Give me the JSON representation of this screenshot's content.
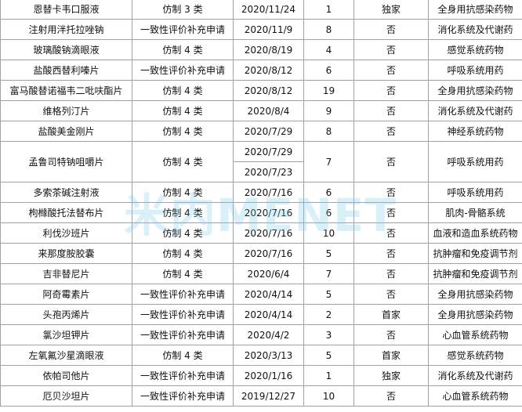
{
  "table": {
    "rows": [
      {
        "name": "恩替卡韦口服液",
        "type": "仿制 3 类",
        "dates": [
          "2020/11/24"
        ],
        "count": "1",
        "first": "独家",
        "category": "全身用抗感染药物"
      },
      {
        "name": "注射用泮托拉唑钠",
        "type": "一致性评价补充申请",
        "dates": [
          "2020/11/9"
        ],
        "count": "8",
        "first": "否",
        "category": "消化系统及代谢药"
      },
      {
        "name": "玻璃酸钠滴眼液",
        "type": "仿制 4 类",
        "dates": [
          "2020/8/19"
        ],
        "count": "4",
        "first": "否",
        "category": "感觉系统药物"
      },
      {
        "name": "盐酸西替利嗪片",
        "type": "一致性评价补充申请",
        "dates": [
          "2020/8/12"
        ],
        "count": "6",
        "first": "否",
        "category": "呼吸系统用药"
      },
      {
        "name": "富马酸替诺福韦二吡呋酯片",
        "type": "仿制 4 类",
        "dates": [
          "2020/8/12"
        ],
        "count": "19",
        "first": "否",
        "category": "全身用抗感染药物"
      },
      {
        "name": "维格列汀片",
        "type": "仿制 4 类",
        "dates": [
          "2020/8/4"
        ],
        "count": "9",
        "first": "否",
        "category": "消化系统及代谢药"
      },
      {
        "name": "盐酸美金刚片",
        "type": "仿制 4 类",
        "dates": [
          "2020/7/29"
        ],
        "count": "8",
        "first": "否",
        "category": "神经系统药物"
      },
      {
        "name": "孟鲁司特钠咀嚼片",
        "type": "仿制 4 类",
        "dates": [
          "2020/7/29",
          "2020/7/23"
        ],
        "count": "7",
        "first": "否",
        "category": "呼吸系统用药"
      },
      {
        "name": "多索茶碱注射液",
        "type": "仿制 4 类",
        "dates": [
          "2020/7/16"
        ],
        "count": "6",
        "first": "否",
        "category": "呼吸系统用药"
      },
      {
        "name": "枸橼酸托法替布片",
        "type": "仿制 4 类",
        "dates": [
          "2020/7/16"
        ],
        "count": "6",
        "first": "否",
        "category": "肌肉-骨骼系统"
      },
      {
        "name": "利伐沙班片",
        "type": "仿制 4 类",
        "dates": [
          "2020/7/16"
        ],
        "count": "10",
        "first": "否",
        "category": "血液和造血系统药物"
      },
      {
        "name": "来那度胺胶囊",
        "type": "仿制 4 类",
        "dates": [
          "2020/7/16"
        ],
        "count": "5",
        "first": "否",
        "category": "抗肿瘤和免疫调节剂"
      },
      {
        "name": "吉非替尼片",
        "type": "仿制 4 类",
        "dates": [
          "2020/6/4"
        ],
        "count": "7",
        "first": "否",
        "category": "抗肿瘤和免疫调节剂"
      },
      {
        "name": "阿奇霉素片",
        "type": "一致性评价补充申请",
        "dates": [
          "2020/4/14"
        ],
        "count": "5",
        "first": "否",
        "category": "全身用抗感染药物"
      },
      {
        "name": "头孢丙烯片",
        "type": "一致性评价补充申请",
        "dates": [
          "2020/4/14"
        ],
        "count": "2",
        "first": "首家",
        "category": "全身用抗感染药物"
      },
      {
        "name": "氯沙坦钾片",
        "type": "一致性评价补充申请",
        "dates": [
          "2020/4/2"
        ],
        "count": "3",
        "first": "否",
        "category": "心血管系统药物"
      },
      {
        "name": "左氧氟沙星滴眼液",
        "type": "仿制 4 类",
        "dates": [
          "2020/3/13"
        ],
        "count": "5",
        "first": "首家",
        "category": "感觉系统药物"
      },
      {
        "name": "依帕司他片",
        "type": "一致性评价补充申请",
        "dates": [
          "2020/1/16"
        ],
        "count": "1",
        "first": "独家",
        "category": "消化系统及代谢药"
      },
      {
        "name": "厄贝沙坦片",
        "type": "一致性评价补充申请",
        "dates": [
          "2019/12/27"
        ],
        "count": "10",
        "first": "否",
        "category": "心血管系统药物"
      }
    ]
  },
  "watermark": "米内MENET"
}
